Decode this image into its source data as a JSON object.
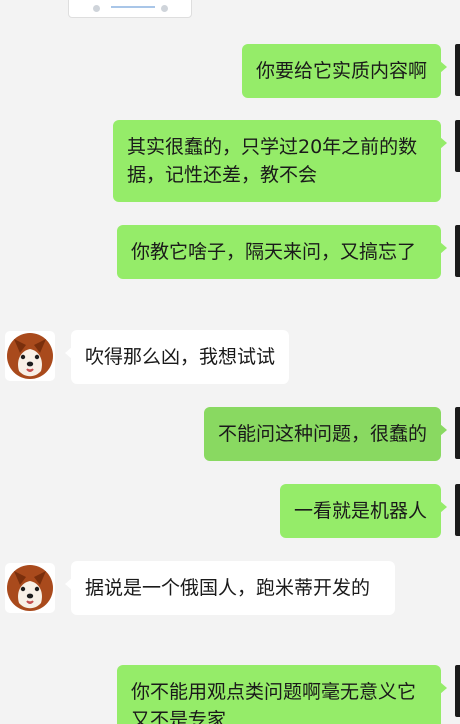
{
  "messages": [
    {
      "from": "me",
      "text": "你要给它实质内容啊"
    },
    {
      "from": "me",
      "text": "其实很蠢的，只学过20年之前的数据，记性还差，教不会"
    },
    {
      "from": "me",
      "text": "你教它啥子，隔天来问，又搞忘了"
    },
    {
      "from": "them",
      "text": "吹得那么凶，我想试试"
    },
    {
      "from": "me",
      "text": "不能问这种问题，很蠢的"
    },
    {
      "from": "me",
      "text": "一看就是机器人"
    },
    {
      "from": "them",
      "text": "据说是一个俄国人，跑米蒂开发的"
    },
    {
      "from": "me",
      "text": "你不能用观点类问题啊毫无意义它又不是专家"
    }
  ],
  "colors": {
    "background": "#f3f3f3",
    "my_bubble": "#95ec69",
    "my_bubble_hover": "#89d961",
    "their_bubble": "#ffffff"
  }
}
